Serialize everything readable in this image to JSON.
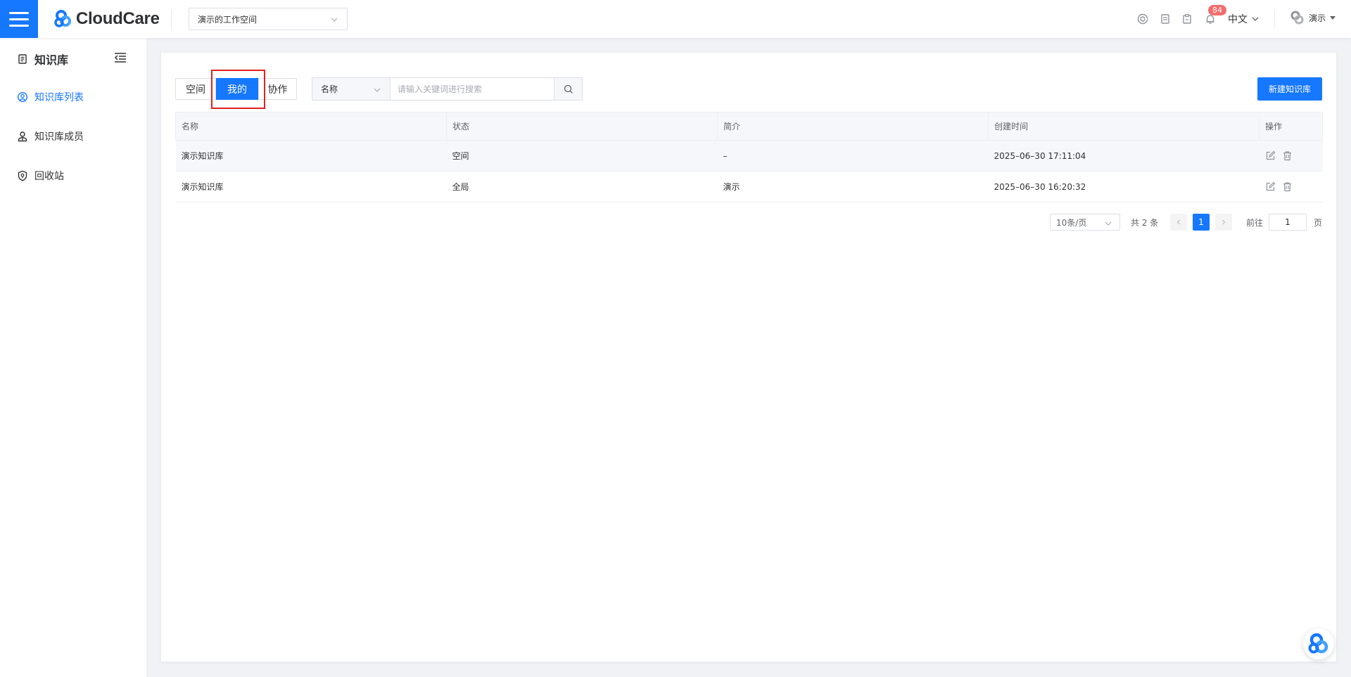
{
  "header": {
    "brand": "CloudCare",
    "workspace": "演示的工作空间",
    "notification_count": "84",
    "language": "中文",
    "user_name": "演示"
  },
  "sidebar": {
    "title": "知识库",
    "items": [
      {
        "label": "知识库列表",
        "icon": "user-circle-icon",
        "active": true
      },
      {
        "label": "知识库成员",
        "icon": "members-icon",
        "active": false
      },
      {
        "label": "回收站",
        "icon": "recycle-shield-icon",
        "active": false
      }
    ]
  },
  "toolbar": {
    "tabs": [
      "空间",
      "我的",
      "协作"
    ],
    "active_tab": "我的",
    "field_select": "名称",
    "search_placeholder": "请输入关键词进行搜索",
    "new_button": "新建知识库"
  },
  "table": {
    "columns": [
      "名称",
      "状态",
      "简介",
      "创建时间",
      "操作"
    ],
    "rows": [
      {
        "name": "演示知识库",
        "status": "空间",
        "intro": "–",
        "created": "2025–06–30 17:11:04"
      },
      {
        "name": "演示知识库",
        "status": "全局",
        "intro": "演示",
        "created": "2025–06–30 16:20:32"
      }
    ]
  },
  "pagination": {
    "page_size": "10条/页",
    "total": "共 2 条",
    "current_page": "1",
    "goto_label": "前往",
    "goto_value": "1",
    "page_suffix": "页"
  },
  "colors": {
    "primary": "#1677ff",
    "badge": "#f56c6c",
    "highlight_box": "#e02020"
  }
}
